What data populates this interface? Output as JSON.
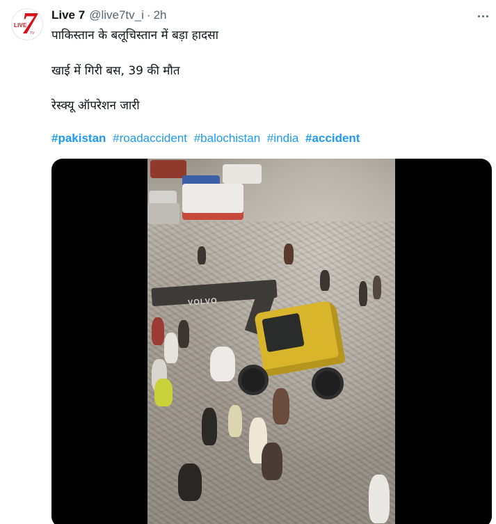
{
  "tweet": {
    "display_name": "Live 7",
    "handle": "@live7tv_i",
    "separator": "·",
    "time": "2h",
    "lines": [
      "पाकिस्तान के बलूचिस्तान में बड़ा हादसा",
      "खाई में गिरी बस, 39 की मौत",
      "रेस्क्यू ऑपरेशन जारी"
    ],
    "hashtags": [
      {
        "text": "#pakistan",
        "bold": true
      },
      {
        "text": "#roadaccident",
        "bold": false
      },
      {
        "text": "#balochistan",
        "bold": false
      },
      {
        "text": "#india",
        "bold": false
      },
      {
        "text": "#accident",
        "bold": true
      }
    ]
  },
  "avatar": {
    "logo_text": "LIVE",
    "logo_number": "7",
    "logo_sub": "TV",
    "brand_color": "#d4141c"
  },
  "media": {
    "type": "video",
    "excavator_brand": "VOLVO"
  },
  "colors": {
    "link": "#1d9bf0",
    "secondary_text": "#536471",
    "primary_text": "#0f1419"
  },
  "icons": {
    "more": "more-horizontal-icon"
  }
}
